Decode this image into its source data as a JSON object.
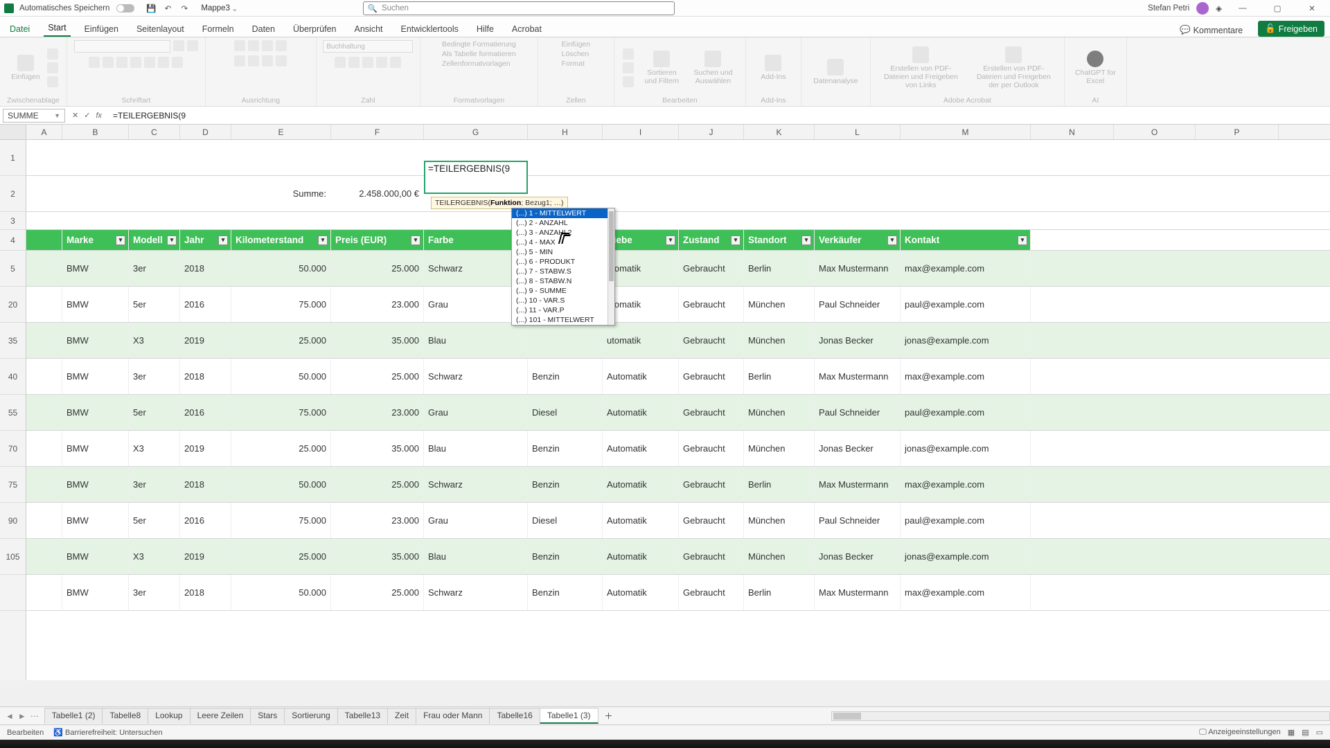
{
  "titlebar": {
    "autosave": "Automatisches Speichern",
    "docname": "Mappe3",
    "search_placeholder": "Suchen",
    "user": "Stefan Petri",
    "min": "—",
    "max": "▢",
    "close": "✕"
  },
  "tabs": {
    "file": "Datei",
    "items": [
      "Start",
      "Einfügen",
      "Seitenlayout",
      "Formeln",
      "Daten",
      "Überprüfen",
      "Ansicht",
      "Entwicklertools",
      "Hilfe",
      "Acrobat"
    ],
    "active": "Start",
    "comments": "Kommentare",
    "share": "Freigeben"
  },
  "ribbon": {
    "clipboard": {
      "label": "Zwischenablage",
      "paste": "Einfügen"
    },
    "font": {
      "label": "Schriftart"
    },
    "align": {
      "label": "Ausrichtung"
    },
    "number": {
      "label": "Zahl",
      "format": "Buchhaltung"
    },
    "styles": {
      "label": "Formatvorlagen",
      "cond": "Bedingte Formatierung",
      "astable": "Als Tabelle formatieren",
      "cellstyles": "Zellenformatvorlagen"
    },
    "cells": {
      "label": "Zellen",
      "ins": "Einfügen",
      "del": "Löschen",
      "fmt": "Format"
    },
    "editing": {
      "label": "Bearbeiten",
      "sort": "Sortieren und Filtern",
      "find": "Suchen und Auswählen"
    },
    "addins": {
      "label": "Add-Ins",
      "btn": "Add-Ins"
    },
    "analysis": {
      "label": "",
      "btn": "Datenanalyse"
    },
    "acrobat": {
      "label": "Adobe Acrobat",
      "a": "Erstellen von PDF-Dateien und Freigeben von Links",
      "b": "Erstellen von PDF-Dateien und Freigeben der per Outlook"
    },
    "ai": {
      "label": "AI",
      "btn": "ChatGPT for Excel"
    }
  },
  "namebox": "SUMME",
  "formula": "=TEILERGEBNIS(9",
  "fn_tooltip_prefix": "TEILERGEBNIS(",
  "fn_tooltip_bold": "Funktion",
  "fn_tooltip_suffix": "; Bezug1; …)",
  "intellisense": [
    "(...) 1 - MITTELWERT",
    "(...) 2 - ANZAHL",
    "(...) 3 - ANZAHL2",
    "(...) 4 - MAX",
    "(...) 5 - MIN",
    "(...) 6 - PRODUKT",
    "(...) 7 - STABW.S",
    "(...) 8 - STABW.N",
    "(...) 9 - SUMME",
    "(...) 10 - VAR.S",
    "(...) 11 - VAR.P",
    "(...) 101 - MITTELWERT"
  ],
  "columns": [
    "A",
    "B",
    "C",
    "D",
    "E",
    "F",
    "G",
    "H",
    "I",
    "J",
    "K",
    "L",
    "M",
    "N",
    "O",
    "P"
  ],
  "summary": {
    "label": "Summe:",
    "value": "2.458.000,00 €"
  },
  "headers": [
    "Marke",
    "Modell",
    "Jahr",
    "Kilometerstand",
    "Preis (EUR)",
    "Farbe",
    "",
    "triebe",
    "Zustand",
    "Standort",
    "Verkäufer",
    "Kontakt"
  ],
  "row_numbers_top": [
    "1",
    "2",
    "3",
    "4"
  ],
  "data_row_numbers": [
    "5",
    "20",
    "35",
    "40",
    "55",
    "70",
    "75",
    "90",
    "105",
    ""
  ],
  "rows": [
    {
      "marke": "BMW",
      "modell": "3er",
      "jahr": "2018",
      "km": "50.000",
      "preis": "25.000",
      "farbe": "Schwarz",
      "kraft": "",
      "getriebe": "utomatik",
      "zustand": "Gebraucht",
      "ort": "Berlin",
      "verk": "Max Mustermann",
      "kontakt": "max@example.com"
    },
    {
      "marke": "BMW",
      "modell": "5er",
      "jahr": "2016",
      "km": "75.000",
      "preis": "23.000",
      "farbe": "Grau",
      "kraft": "",
      "getriebe": "utomatik",
      "zustand": "Gebraucht",
      "ort": "München",
      "verk": "Paul Schneider",
      "kontakt": "paul@example.com"
    },
    {
      "marke": "BMW",
      "modell": "X3",
      "jahr": "2019",
      "km": "25.000",
      "preis": "35.000",
      "farbe": "Blau",
      "kraft": "",
      "getriebe": "utomatik",
      "zustand": "Gebraucht",
      "ort": "München",
      "verk": "Jonas Becker",
      "kontakt": "jonas@example.com"
    },
    {
      "marke": "BMW",
      "modell": "3er",
      "jahr": "2018",
      "km": "50.000",
      "preis": "25.000",
      "farbe": "Schwarz",
      "kraft": "Benzin",
      "getriebe": "Automatik",
      "zustand": "Gebraucht",
      "ort": "Berlin",
      "verk": "Max Mustermann",
      "kontakt": "max@example.com"
    },
    {
      "marke": "BMW",
      "modell": "5er",
      "jahr": "2016",
      "km": "75.000",
      "preis": "23.000",
      "farbe": "Grau",
      "kraft": "Diesel",
      "getriebe": "Automatik",
      "zustand": "Gebraucht",
      "ort": "München",
      "verk": "Paul Schneider",
      "kontakt": "paul@example.com"
    },
    {
      "marke": "BMW",
      "modell": "X3",
      "jahr": "2019",
      "km": "25.000",
      "preis": "35.000",
      "farbe": "Blau",
      "kraft": "Benzin",
      "getriebe": "Automatik",
      "zustand": "Gebraucht",
      "ort": "München",
      "verk": "Jonas Becker",
      "kontakt": "jonas@example.com"
    },
    {
      "marke": "BMW",
      "modell": "3er",
      "jahr": "2018",
      "km": "50.000",
      "preis": "25.000",
      "farbe": "Schwarz",
      "kraft": "Benzin",
      "getriebe": "Automatik",
      "zustand": "Gebraucht",
      "ort": "Berlin",
      "verk": "Max Mustermann",
      "kontakt": "max@example.com"
    },
    {
      "marke": "BMW",
      "modell": "5er",
      "jahr": "2016",
      "km": "75.000",
      "preis": "23.000",
      "farbe": "Grau",
      "kraft": "Diesel",
      "getriebe": "Automatik",
      "zustand": "Gebraucht",
      "ort": "München",
      "verk": "Paul Schneider",
      "kontakt": "paul@example.com"
    },
    {
      "marke": "BMW",
      "modell": "X3",
      "jahr": "2019",
      "km": "25.000",
      "preis": "35.000",
      "farbe": "Blau",
      "kraft": "Benzin",
      "getriebe": "Automatik",
      "zustand": "Gebraucht",
      "ort": "München",
      "verk": "Jonas Becker",
      "kontakt": "jonas@example.com"
    },
    {
      "marke": "BMW",
      "modell": "3er",
      "jahr": "2018",
      "km": "50.000",
      "preis": "25.000",
      "farbe": "Schwarz",
      "kraft": "Benzin",
      "getriebe": "Automatik",
      "zustand": "Gebraucht",
      "ort": "Berlin",
      "verk": "Max Mustermann",
      "kontakt": "max@example.com"
    }
  ],
  "sheets": [
    "Tabelle1 (2)",
    "Tabelle8",
    "Lookup",
    "Leere Zeilen",
    "Stars",
    "Sortierung",
    "Tabelle13",
    "Zeit",
    "Frau oder Mann",
    "Tabelle16",
    "Tabelle1 (3)"
  ],
  "active_sheet": "Tabelle1 (3)",
  "status": {
    "mode": "Bearbeiten",
    "access": "Barrierefreiheit: Untersuchen",
    "display": "Anzeigeeinstellungen"
  }
}
